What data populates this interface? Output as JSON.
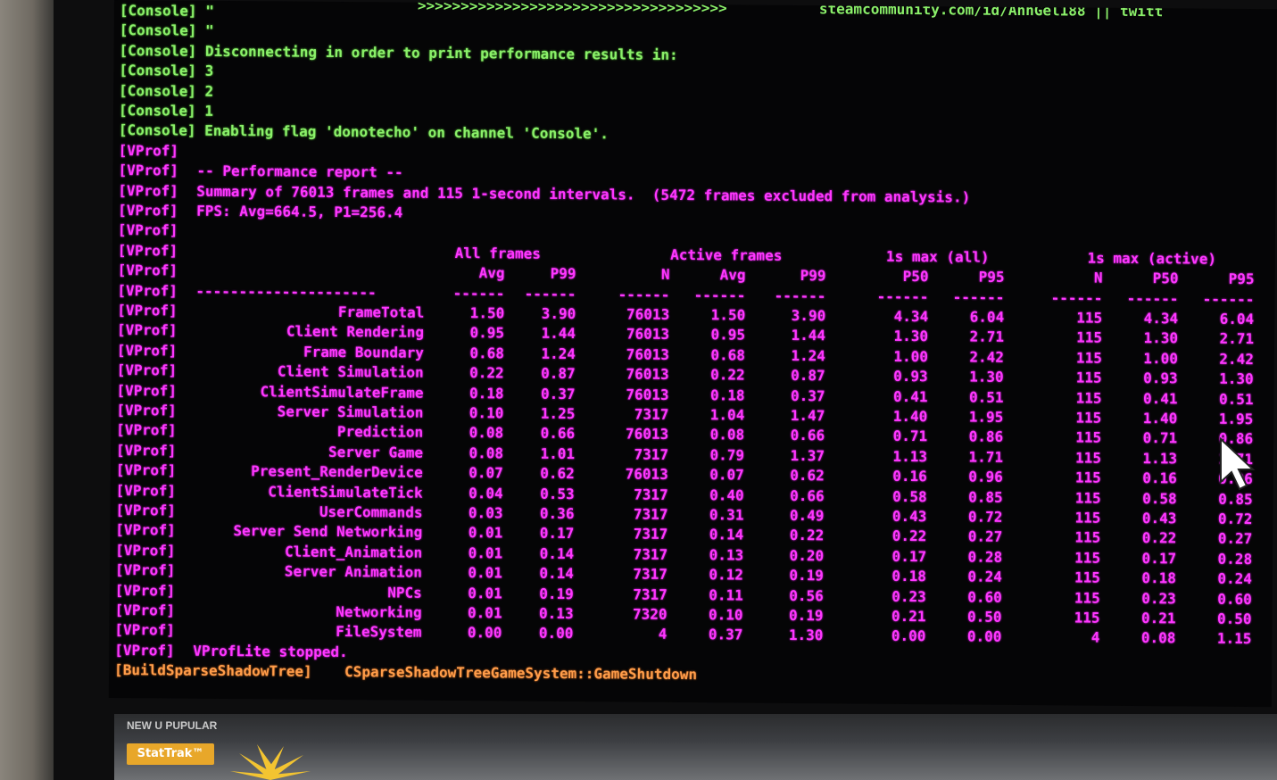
{
  "console": {
    "header_arrows": ">>>>>>>>>>>>>>>>>>>>>>>>>>>>>>>>>>>>",
    "header_url": "steamcommunity.com/id/AnnGel188 || twitt",
    "lines": [
      "[Console] \"",
      "[Console] \"",
      "[Console] Disconnecting in order to print performance results in:",
      "[Console] 3",
      "[Console] 2",
      "[Console] 1",
      "[Console] Enabling flag 'donotecho' on channel 'Console'."
    ]
  },
  "vprof": {
    "prefix": "[VProf]",
    "report_title": "-- Performance report --",
    "summary": "Summary of 76013 frames and 115 1-second intervals.  (5472 frames excluded from analysis.)",
    "fps": "FPS: Avg=664.5, P1=256.4",
    "group_headers": {
      "all_frames": "All frames",
      "active_frames": "Active frames",
      "max_all": "1s max (all)",
      "max_active": "1s max (active)"
    },
    "col_headers": [
      "Avg",
      "P99",
      "N",
      "Avg",
      "P99",
      "P50",
      "P95",
      "N",
      "P50",
      "P95"
    ],
    "separator_label": "---------------------",
    "separator_col": "------",
    "rows": [
      [
        "FrameTotal",
        "1.50",
        "3.90",
        "76013",
        "1.50",
        "3.90",
        "4.34",
        "6.04",
        "115",
        "4.34",
        "6.04"
      ],
      [
        "Client Rendering",
        "0.95",
        "1.44",
        "76013",
        "0.95",
        "1.44",
        "1.30",
        "2.71",
        "115",
        "1.30",
        "2.71"
      ],
      [
        "Frame Boundary",
        "0.68",
        "1.24",
        "76013",
        "0.68",
        "1.24",
        "1.00",
        "2.42",
        "115",
        "1.00",
        "2.42"
      ],
      [
        "Client Simulation",
        "0.22",
        "0.87",
        "76013",
        "0.22",
        "0.87",
        "0.93",
        "1.30",
        "115",
        "0.93",
        "1.30"
      ],
      [
        "ClientSimulateFrame",
        "0.18",
        "0.37",
        "76013",
        "0.18",
        "0.37",
        "0.41",
        "0.51",
        "115",
        "0.41",
        "0.51"
      ],
      [
        "Server Simulation",
        "0.10",
        "1.25",
        "7317",
        "1.04",
        "1.47",
        "1.40",
        "1.95",
        "115",
        "1.40",
        "1.95"
      ],
      [
        "Prediction",
        "0.08",
        "0.66",
        "76013",
        "0.08",
        "0.66",
        "0.71",
        "0.86",
        "115",
        "0.71",
        "0.86"
      ],
      [
        "Server Game",
        "0.08",
        "1.01",
        "7317",
        "0.79",
        "1.37",
        "1.13",
        "1.71",
        "115",
        "1.13",
        "1.71"
      ],
      [
        "Present_RenderDevice",
        "0.07",
        "0.62",
        "76013",
        "0.07",
        "0.62",
        "0.16",
        "0.96",
        "115",
        "0.16",
        "0.96"
      ],
      [
        "ClientSimulateTick",
        "0.04",
        "0.53",
        "7317",
        "0.40",
        "0.66",
        "0.58",
        "0.85",
        "115",
        "0.58",
        "0.85"
      ],
      [
        "UserCommands",
        "0.03",
        "0.36",
        "7317",
        "0.31",
        "0.49",
        "0.43",
        "0.72",
        "115",
        "0.43",
        "0.72"
      ],
      [
        "Server Send Networking",
        "0.01",
        "0.17",
        "7317",
        "0.14",
        "0.22",
        "0.22",
        "0.27",
        "115",
        "0.22",
        "0.27"
      ],
      [
        "Client_Animation",
        "0.01",
        "0.14",
        "7317",
        "0.13",
        "0.20",
        "0.17",
        "0.28",
        "115",
        "0.17",
        "0.28"
      ],
      [
        "Server Animation",
        "0.01",
        "0.14",
        "7317",
        "0.12",
        "0.19",
        "0.18",
        "0.24",
        "115",
        "0.18",
        "0.24"
      ],
      [
        "NPCs",
        "0.01",
        "0.19",
        "7317",
        "0.11",
        "0.56",
        "0.23",
        "0.60",
        "115",
        "0.23",
        "0.60"
      ],
      [
        "Networking",
        "0.01",
        "0.13",
        "7320",
        "0.10",
        "0.19",
        "0.21",
        "0.50",
        "115",
        "0.21",
        "0.50"
      ],
      [
        "FileSystem",
        "0.00",
        "0.00",
        "4",
        "0.37",
        "1.30",
        "0.00",
        "0.00",
        "4",
        "0.08",
        "1.15"
      ]
    ],
    "stopped": "VProfLite stopped."
  },
  "build": {
    "prefix": "[BuildSparseShadowTree]",
    "message": "CSparseShadowTreeGameSystem::GameShutdown"
  },
  "game_ui": {
    "stattrak_label": "StatTrak™",
    "hud_text": "NEW U PUPULAR"
  },
  "colors": {
    "console_green": "#8bf06a",
    "vprof_magenta": "#ff37ff",
    "build_orange": "#ff9d4a",
    "screen_bg": "#050506"
  }
}
